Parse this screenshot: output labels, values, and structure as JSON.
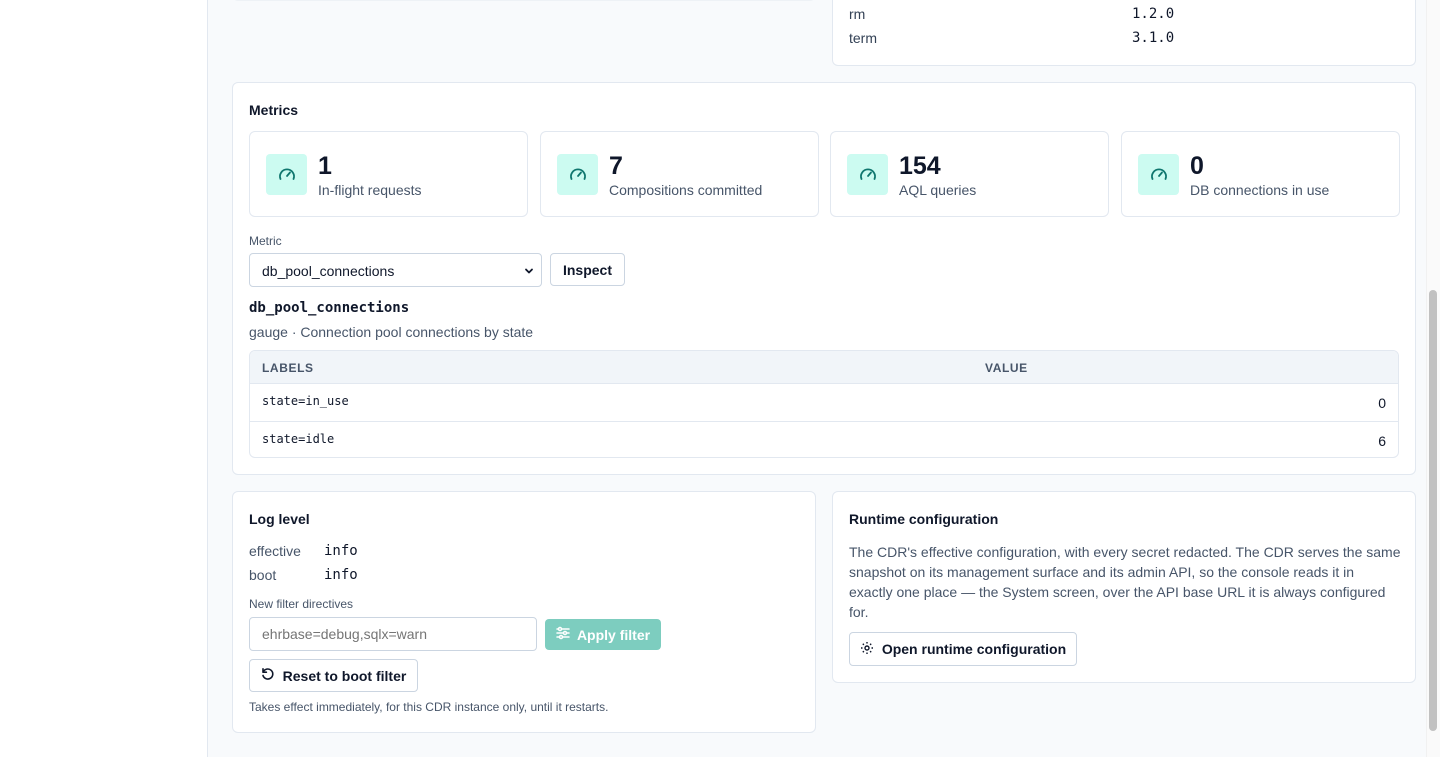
{
  "versions": [
    {
      "name": "rm",
      "version": "1.2.0"
    },
    {
      "name": "term",
      "version": "3.1.0"
    }
  ],
  "metrics": {
    "title": "Metrics",
    "stats": [
      {
        "value": "1",
        "label": "In-flight requests",
        "icon": "gauge-icon"
      },
      {
        "value": "7",
        "label": "Compositions committed",
        "icon": "gauge-icon"
      },
      {
        "value": "154",
        "label": "AQL queries",
        "icon": "gauge-icon"
      },
      {
        "value": "0",
        "label": "DB connections in use",
        "icon": "gauge-icon"
      }
    ],
    "metric_label": "Metric",
    "selected_metric": "db_pool_connections",
    "inspect_label": "Inspect",
    "metric_name": "db_pool_connections",
    "metric_desc": "gauge · Connection pool connections by state",
    "table": {
      "headers": [
        "LABELS",
        "VALUE"
      ],
      "rows": [
        {
          "labels": "state=in_use",
          "value": "0"
        },
        {
          "labels": "state=idle",
          "value": "6"
        }
      ]
    }
  },
  "log_level": {
    "title": "Log level",
    "effective_key": "effective",
    "effective_val": "info",
    "boot_key": "boot",
    "boot_val": "info",
    "directives_label": "New filter directives",
    "directives_placeholder": "ehrbase=debug,sqlx=warn",
    "apply_label": "Apply filter",
    "reset_label": "Reset to boot filter",
    "hint": "Takes effect immediately, for this CDR instance only, until it restarts."
  },
  "runtime": {
    "title": "Runtime configuration",
    "description": "The CDR's effective configuration, with every secret redacted. The CDR serves the same snapshot on its management surface and its admin API, so the console reads it in exactly one place — the System screen, over the API base URL it is always configured for.",
    "open_label": "Open runtime configuration"
  },
  "colors": {
    "accent": "#0f766e",
    "accent_light": "#ccfbf1",
    "apply_button": "#7dcdbf"
  }
}
